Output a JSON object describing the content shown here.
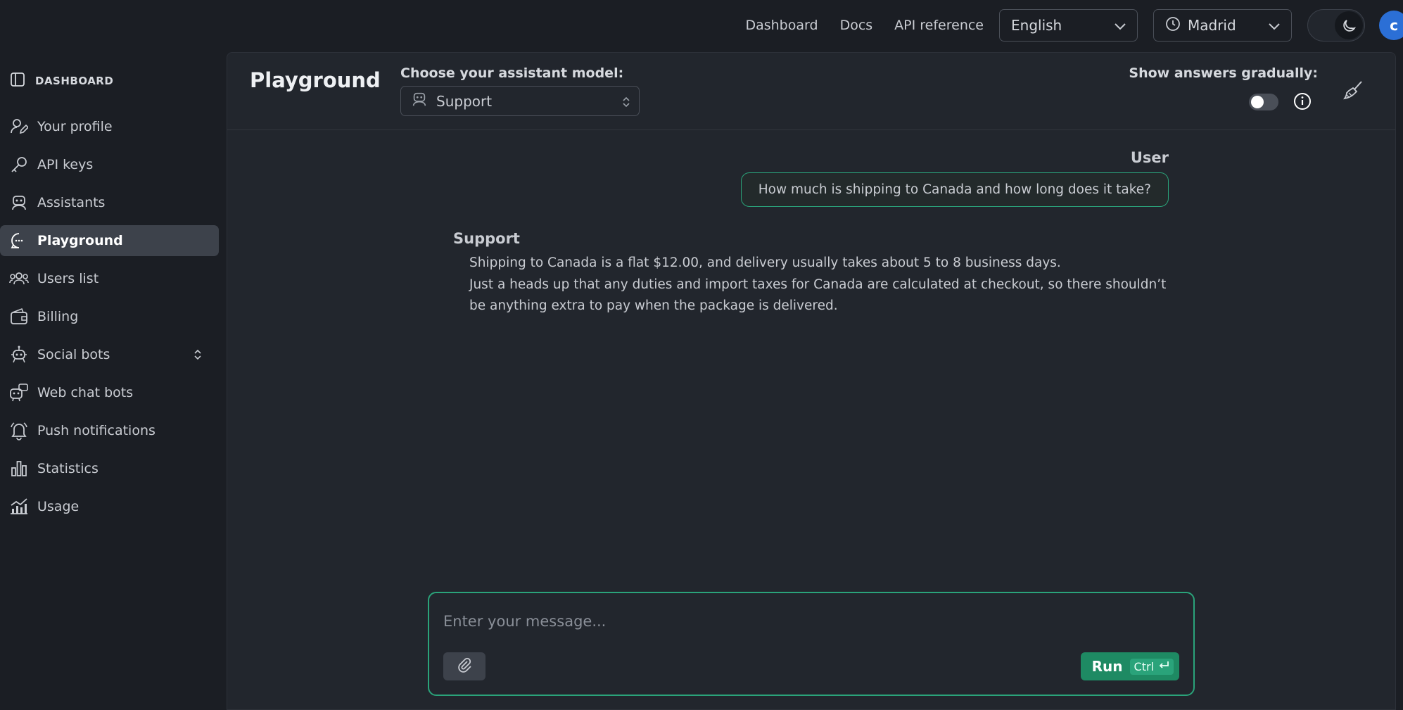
{
  "topnav": {
    "links": [
      "Dashboard",
      "Docs",
      "API reference"
    ],
    "language": "English",
    "timezone": "Madrid",
    "avatar_initial": "c"
  },
  "sidebar": {
    "header": "DASHBOARD",
    "items": [
      {
        "label": "Your profile",
        "icon": "user-edit-icon"
      },
      {
        "label": "API keys",
        "icon": "key-icon"
      },
      {
        "label": "Assistants",
        "icon": "robot-icon"
      },
      {
        "label": "Playground",
        "icon": "chat-bubble-icon",
        "active": true
      },
      {
        "label": "Users list",
        "icon": "users-icon"
      },
      {
        "label": "Billing",
        "icon": "wallet-icon"
      },
      {
        "label": "Social bots",
        "icon": "social-bot-icon"
      },
      {
        "label": "Web chat bots",
        "icon": "web-chat-bot-icon"
      },
      {
        "label": "Push notifications",
        "icon": "bell-icon"
      },
      {
        "label": "Statistics",
        "icon": "bar-chart-icon"
      },
      {
        "label": "Usage",
        "icon": "usage-chart-icon"
      }
    ]
  },
  "playground": {
    "title": "Playground",
    "model_label": "Choose your assistant model:",
    "model_value": "Support",
    "gradual_label": "Show answers gradually:",
    "gradual_enabled": false
  },
  "conversation": {
    "user_name": "User",
    "user_message": "How much is shipping to Canada and how long does it take?",
    "bot_name": "Support",
    "bot_lines": [
      "Shipping to Canada is a flat $12.00, and delivery usually takes about 5 to 8 business days.",
      "Just a heads up that any duties and import taxes for Canada are calculated at checkout, so there shouldn’t be anything extra to pay when the package is delivered."
    ]
  },
  "composer": {
    "placeholder": "Enter your message...",
    "run_label": "Run",
    "shortcut": "Ctrl"
  },
  "colors": {
    "accent": "#2aa37a",
    "run_button": "#1e8a63",
    "avatar": "#2b6fd6"
  }
}
